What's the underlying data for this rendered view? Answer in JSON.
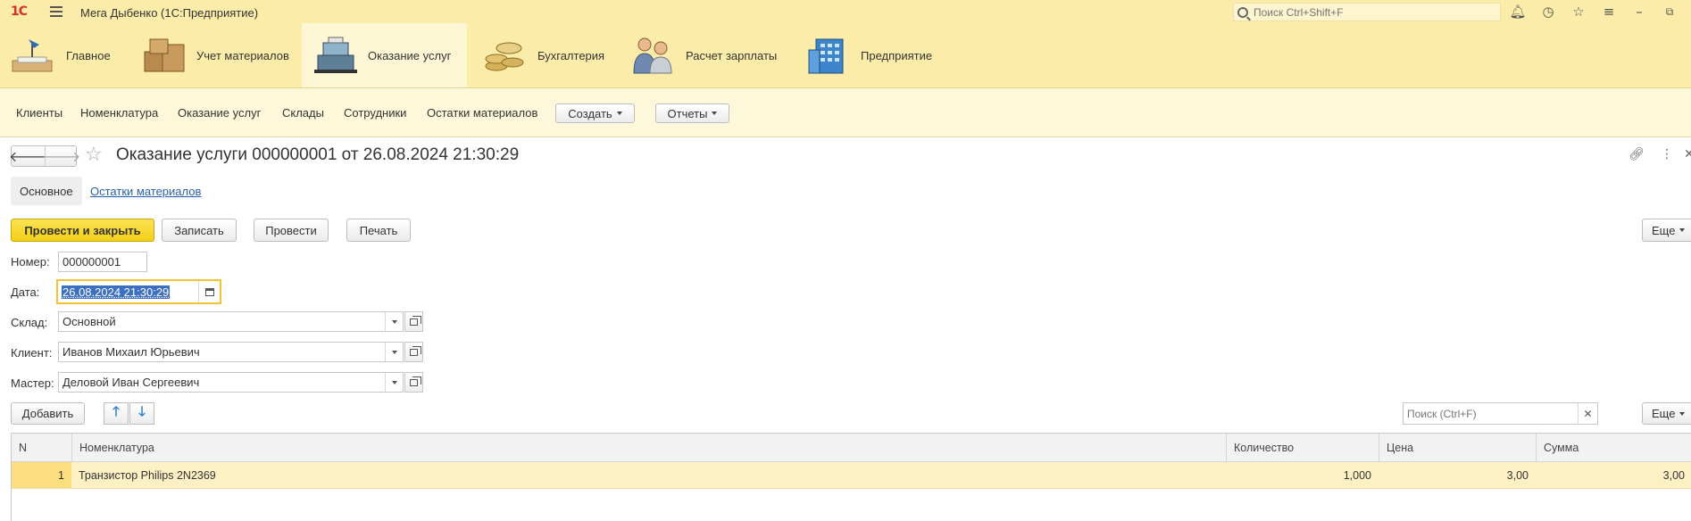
{
  "window": {
    "title": "Мега Дыбенко  (1С:Предприятие)",
    "logo": "1С",
    "search_placeholder": "Поиск Ctrl+Shift+F",
    "icons": [
      "bell-icon",
      "history-icon",
      "star-icon",
      "settings-menu-icon",
      "minimize-icon",
      "restore-icon"
    ]
  },
  "sections": [
    {
      "label": "Главное",
      "icon": "desk-lamp-icon"
    },
    {
      "label": "Учет материалов",
      "icon": "boxes-icon"
    },
    {
      "label": "Оказание услуг",
      "icon": "cash-register-icon"
    },
    {
      "label": "Бухгалтерия",
      "icon": "coins-icon"
    },
    {
      "label": "Расчет зарплаты",
      "icon": "people-icon"
    },
    {
      "label": "Предприятие",
      "icon": "building-icon"
    }
  ],
  "nav": {
    "links": [
      "Клиенты",
      "Номенклатура",
      "Оказание услуг",
      "Склады",
      "Сотрудники",
      "Остатки материалов"
    ],
    "create_label": "Создать",
    "reports_label": "Отчеты"
  },
  "form": {
    "title": "Оказание услуги 000000001 от 26.08.2024 21:30:29",
    "tab_main": "Основное",
    "tab_link": "Остатки материалов",
    "buttons": {
      "post_close": "Провести и закрыть",
      "save": "Записать",
      "post": "Провести",
      "print": "Печать",
      "more": "Еще"
    },
    "fields": {
      "number_label": "Номер:",
      "number_value": "000000001",
      "date_label": "Дата:",
      "date_value": "26.08.2024 21:30:29",
      "warehouse_label": "Склад:",
      "warehouse_value": "Основной",
      "client_label": "Клиент:",
      "client_value": "Иванов Михаил Юрьевич",
      "master_label": "Мастер:",
      "master_value": "Деловой Иван Сергеевич"
    }
  },
  "table": {
    "add_label": "Добавить",
    "search_placeholder": "Поиск (Ctrl+F)",
    "more_label": "Еще",
    "columns": [
      "N",
      "Номенклатура",
      "Количество",
      "Цена",
      "Сумма"
    ],
    "rows": [
      {
        "n": "1",
        "item": "Транзистор Philips 2N2369",
        "qty": "1,000",
        "price": "3,00",
        "sum": "3,00"
      }
    ]
  },
  "colors": {
    "header_bg": "#fbeda9",
    "accent": "#f3cf16",
    "selection": "#3b6fc1"
  }
}
